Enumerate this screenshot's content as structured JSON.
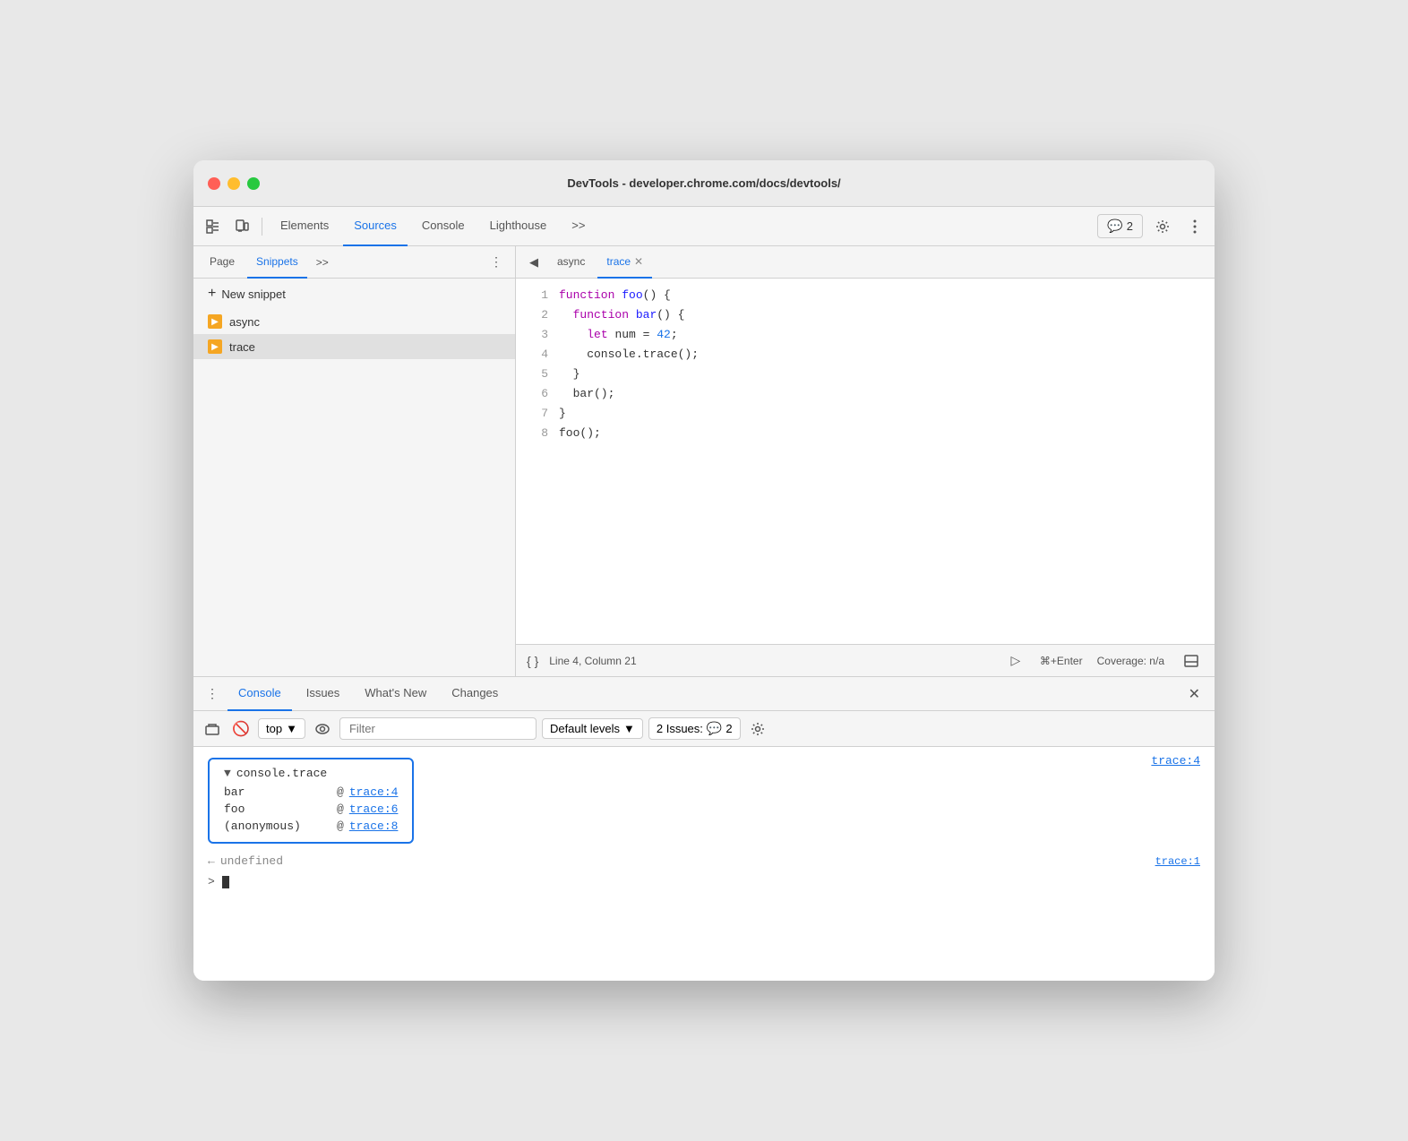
{
  "window": {
    "title": "DevTools - developer.chrome.com/docs/devtools/"
  },
  "top_toolbar": {
    "elements_tab": "Elements",
    "sources_tab": "Sources",
    "console_tab": "Console",
    "lighthouse_tab": "Lighthouse",
    "more_tabs": ">>",
    "issues_count": "2",
    "settings_label": "Settings"
  },
  "left_panel": {
    "page_tab": "Page",
    "snippets_tab": "Snippets",
    "more_tab": ">>",
    "new_snippet_label": "New snippet",
    "snippets": [
      {
        "name": "async",
        "active": false
      },
      {
        "name": "trace",
        "active": true
      }
    ]
  },
  "editor": {
    "collapse_label": "◀",
    "tab_async": "async",
    "tab_trace": "trace",
    "code_lines": [
      {
        "num": "1",
        "code": "function foo() {"
      },
      {
        "num": "2",
        "code": "  function bar() {"
      },
      {
        "num": "3",
        "code": "    let num = 42;"
      },
      {
        "num": "4",
        "code": "    console.trace();"
      },
      {
        "num": "5",
        "code": "  }"
      },
      {
        "num": "6",
        "code": "  bar();"
      },
      {
        "num": "7",
        "code": "}"
      },
      {
        "num": "8",
        "code": "foo();"
      }
    ],
    "status": {
      "format_label": "{ }",
      "position": "Line 4, Column 21",
      "run_shortcut": "⌘+Enter",
      "coverage": "Coverage: n/a"
    }
  },
  "bottom_panel": {
    "tabs": [
      {
        "name": "Console",
        "active": true
      },
      {
        "name": "Issues",
        "active": false
      },
      {
        "name": "What's New",
        "active": false
      },
      {
        "name": "Changes",
        "active": false
      }
    ],
    "console_toolbar": {
      "top_label": "top",
      "filter_placeholder": "Filter",
      "levels_label": "Default levels",
      "issues_label": "2 Issues:",
      "issues_count": "2"
    },
    "trace_output": {
      "header": "console.trace",
      "location": "trace:4",
      "rows": [
        {
          "func": "bar",
          "at": "@",
          "link": "trace:4"
        },
        {
          "func": "foo",
          "at": "@",
          "link": "trace:6"
        },
        {
          "func": "(anonymous)",
          "at": "@",
          "link": "trace:8"
        }
      ]
    },
    "undefined_text": "← undefined",
    "undefined_location": "trace:1",
    "prompt_symbol": ">"
  }
}
